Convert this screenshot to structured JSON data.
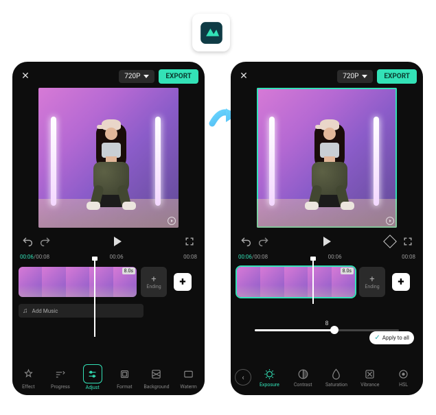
{
  "logo": {
    "brand": "Filmora"
  },
  "topbar": {
    "resolution": "720P",
    "export": "EXPORT"
  },
  "transport": {
    "time_current": "00:06",
    "time_total": "00:08",
    "ticks": [
      "00:06",
      "00:08"
    ]
  },
  "timeline": {
    "clip_duration": "8.0s",
    "ending": "Ending",
    "add_music": "Add Music"
  },
  "tabs_left": {
    "effect": "Effect",
    "progress": "Progress",
    "adjust": "Adjust",
    "format": "Format",
    "background": "Background",
    "watermark": "Waterm"
  },
  "adjust": {
    "value": "8",
    "apply_all": "Apply to all",
    "tabs": {
      "exposure": "Exposure",
      "contrast": "Contrast",
      "saturation": "Saturation",
      "vibrance": "Vibrance",
      "hsl": "HSL"
    }
  }
}
